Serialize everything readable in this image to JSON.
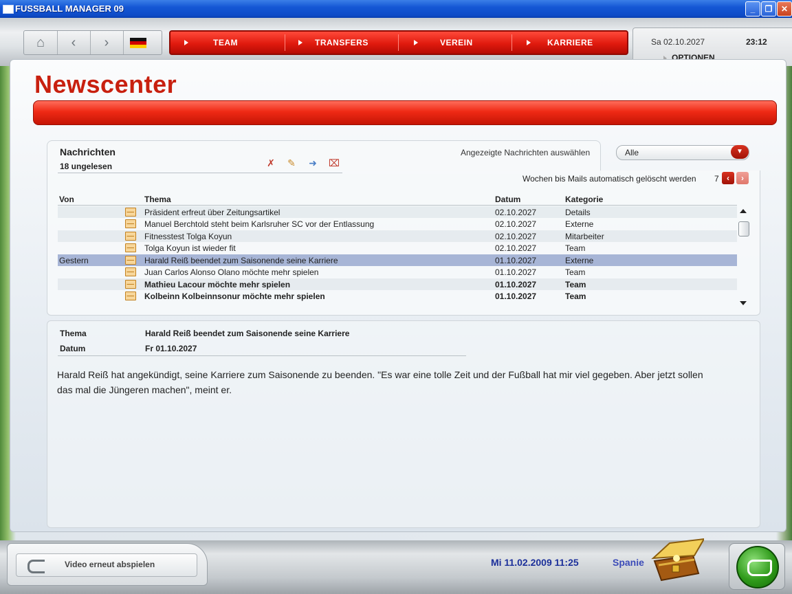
{
  "window": {
    "title": "FUSSBALL MANAGER 09"
  },
  "nav": {
    "items": [
      "TEAM",
      "TRANSFERS",
      "VEREIN",
      "KARRIERE"
    ],
    "game_date": "Sa 02.10.2027",
    "game_time": "23:12",
    "options_label": "OPTIONEN"
  },
  "page": {
    "title": "Newscenter"
  },
  "messages": {
    "title": "Nachrichten",
    "unread": "18 ungelesen",
    "filter_label": "Angezeigte Nachrichten auswählen",
    "filter_value": "Alle",
    "weeks_label": "Wochen bis Mails automatisch gelöscht werden",
    "weeks_value": "7",
    "columns": {
      "from": "Von",
      "subject": "Thema",
      "date": "Datum",
      "category": "Kategorie"
    },
    "rows": [
      {
        "from": "",
        "subject": "Präsident erfreut über Zeitungsartikel",
        "date": "02.10.2027",
        "category": "Details"
      },
      {
        "from": "",
        "subject": "Manuel Berchtold steht beim Karlsruher SC vor der Entlassung",
        "date": "02.10.2027",
        "category": "Externe"
      },
      {
        "from": "",
        "subject": "Fitnesstest Tolga Koyun",
        "date": "02.10.2027",
        "category": "Mitarbeiter"
      },
      {
        "from": "",
        "subject": "Tolga Koyun ist wieder fit",
        "date": "02.10.2027",
        "category": "Team"
      },
      {
        "from": "Gestern",
        "subject": "Harald Reiß beendet zum Saisonende seine Karriere",
        "date": "01.10.2027",
        "category": "Externe"
      },
      {
        "from": "",
        "subject": "Juan Carlos Alonso Olano möchte mehr spielen",
        "date": "01.10.2027",
        "category": "Team"
      },
      {
        "from": "",
        "subject": "Mathieu Lacour möchte mehr spielen",
        "date": "01.10.2027",
        "category": "Team"
      },
      {
        "from": "",
        "subject": "Kolbeinn Kolbeinnsonur möchte mehr spielen",
        "date": "01.10.2027",
        "category": "Team"
      }
    ]
  },
  "detail": {
    "subject_label": "Thema",
    "subject": "Harald Reiß beendet zum Saisonende seine Karriere",
    "date_label": "Datum",
    "date": "Fr 01.10.2027",
    "body": "Harald Reiß hat angekündigt, seine Karriere zum Saisonende zu beenden. \"Es war eine tolle Zeit und der Fußball hat mir viel gegeben. Aber jetzt sollen das mal die Jüngeren machen\", meint er."
  },
  "footer": {
    "video_label": "Video erneut abspielen",
    "real_datetime": "Mi 11.02.2009 11:25",
    "country": "Spanie"
  },
  "colors": {
    "accent": "#e01a0e",
    "selected_row": "#a7b5d6",
    "footer_date": "#1b2f9a"
  },
  "icons": [
    "home-icon",
    "back-icon",
    "forward-icon",
    "german-flag-icon",
    "delete-icon",
    "mark-read-icon",
    "forward-mail-icon",
    "delete-all-icon",
    "mail-icon",
    "treasure-chest-icon",
    "whistle-icon"
  ]
}
